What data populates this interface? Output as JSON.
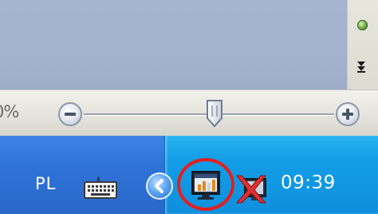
{
  "zoom": {
    "percent_label": "0%",
    "slider_position": 0.5,
    "zoom_out_symbol": "−",
    "zoom_in_symbol": "+"
  },
  "taskbar": {
    "language": "PL",
    "clock": "09:39"
  },
  "icons": {
    "status": "green-dot-icon",
    "scroll": "double-chevron-down-icon",
    "keyboard": "keyboard-icon",
    "expand": "chevron-left-icon",
    "monitor": "monitor-chart-icon",
    "network": "network-disconnected-icon"
  },
  "colors": {
    "taskbar": "#2f72d8",
    "tray": "#139ee6",
    "highlight": "#e41e1e",
    "window": "#a3b1cf"
  }
}
